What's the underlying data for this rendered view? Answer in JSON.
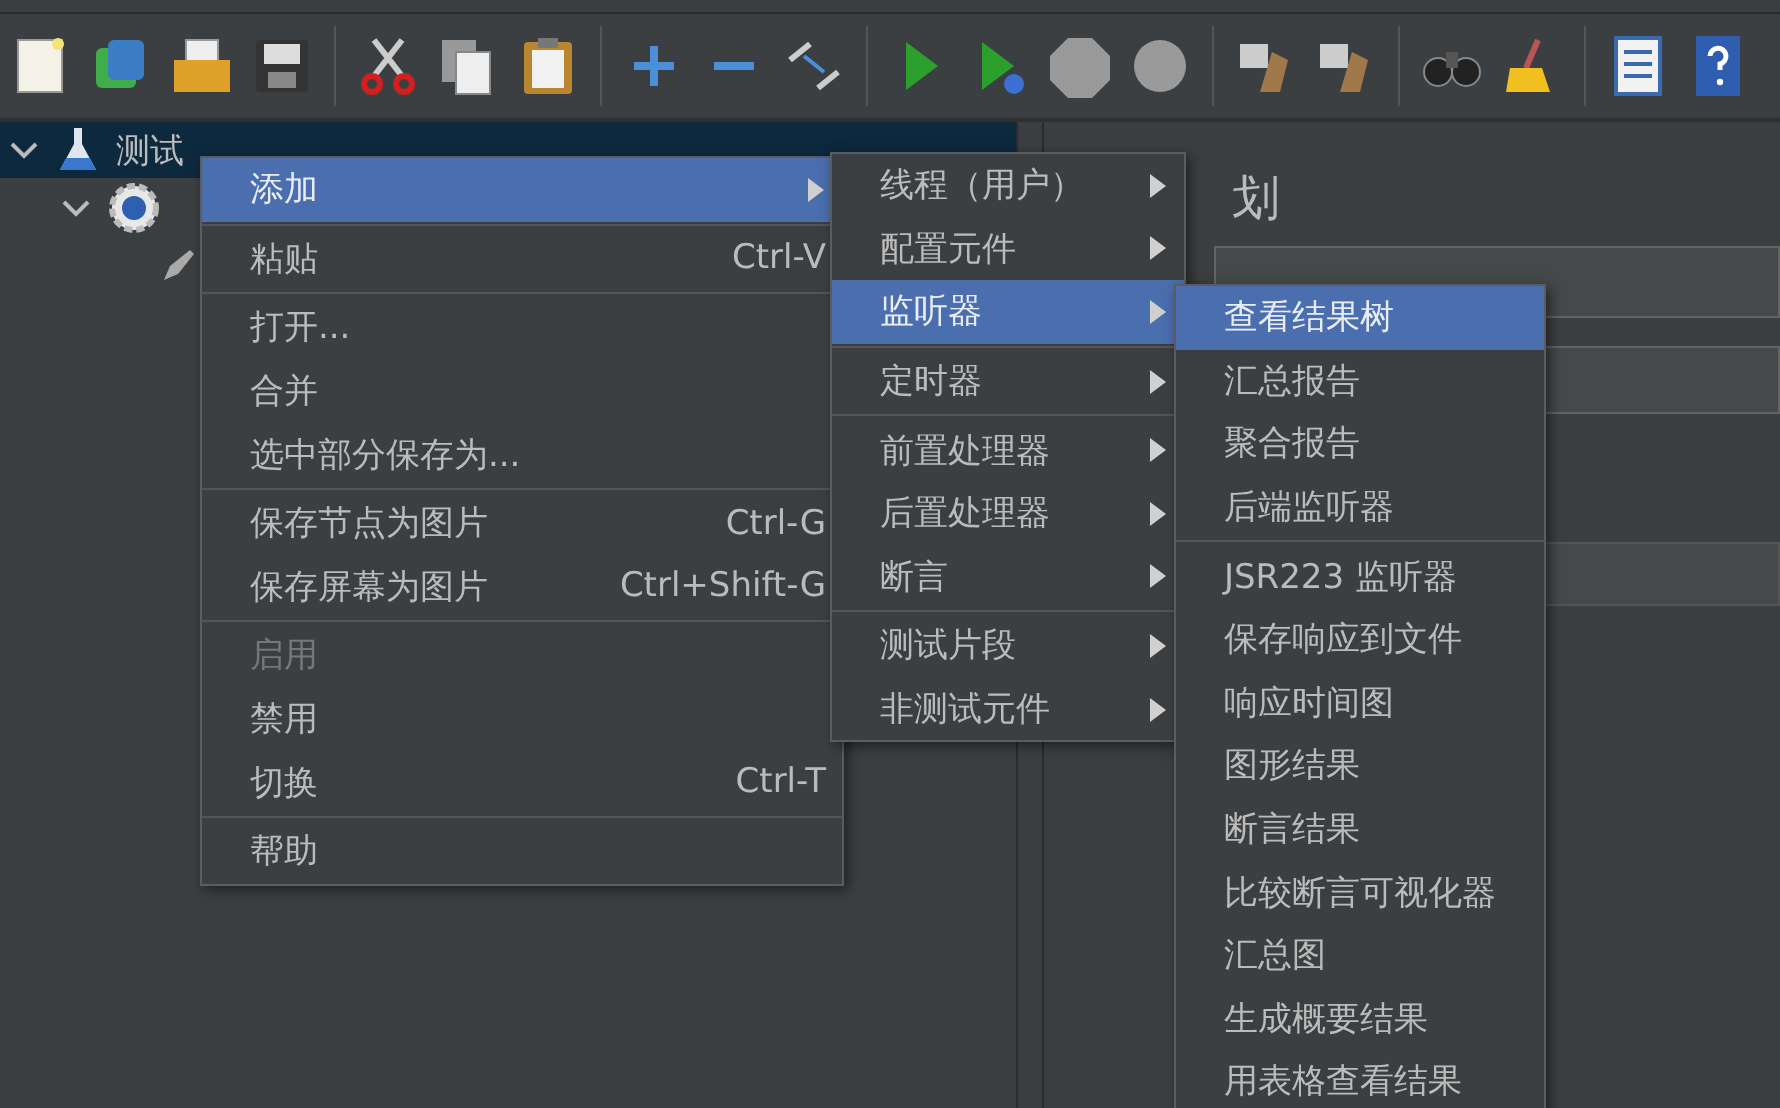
{
  "tree": {
    "items": [
      {
        "label": "测试",
        "selected": true,
        "expanded": true
      }
    ]
  },
  "panel": {
    "title": "划"
  },
  "menus": [
    {
      "items": [
        {
          "kind": "item",
          "label": "添加",
          "submenu": true,
          "selected": true,
          "disabled": false
        },
        {
          "kind": "separator"
        },
        {
          "kind": "item",
          "label": "粘贴",
          "shortcut": "Ctrl-V",
          "submenu": false,
          "selected": false,
          "disabled": false
        },
        {
          "kind": "separator"
        },
        {
          "kind": "item",
          "label": "打开...",
          "submenu": false,
          "selected": false,
          "disabled": false
        },
        {
          "kind": "item",
          "label": "合并",
          "submenu": false,
          "selected": false,
          "disabled": false
        },
        {
          "kind": "item",
          "label": "选中部分保存为...",
          "submenu": false,
          "selected": false,
          "disabled": false
        },
        {
          "kind": "separator"
        },
        {
          "kind": "item",
          "label": "保存节点为图片",
          "shortcut": "Ctrl-G",
          "submenu": false,
          "selected": false,
          "disabled": false
        },
        {
          "kind": "item",
          "label": "保存屏幕为图片",
          "shortcut": "Ctrl+Shift-G",
          "submenu": false,
          "selected": false,
          "disabled": false
        },
        {
          "kind": "separator"
        },
        {
          "kind": "item",
          "label": "启用",
          "submenu": false,
          "selected": false,
          "disabled": true
        },
        {
          "kind": "item",
          "label": "禁用",
          "submenu": false,
          "selected": false,
          "disabled": false
        },
        {
          "kind": "item",
          "label": "切换",
          "shortcut": "Ctrl-T",
          "submenu": false,
          "selected": false,
          "disabled": false
        },
        {
          "kind": "separator"
        },
        {
          "kind": "item",
          "label": "帮助",
          "submenu": false,
          "selected": false,
          "disabled": false
        }
      ]
    },
    {
      "items": [
        {
          "kind": "item",
          "label": "线程（用户）",
          "submenu": true,
          "selected": false,
          "disabled": false
        },
        {
          "kind": "item",
          "label": "配置元件",
          "submenu": true,
          "selected": false,
          "disabled": false
        },
        {
          "kind": "item",
          "label": "监听器",
          "submenu": true,
          "selected": true,
          "disabled": false
        },
        {
          "kind": "separator"
        },
        {
          "kind": "item",
          "label": "定时器",
          "submenu": true,
          "selected": false,
          "disabled": false
        },
        {
          "kind": "separator"
        },
        {
          "kind": "item",
          "label": "前置处理器",
          "submenu": true,
          "selected": false,
          "disabled": false
        },
        {
          "kind": "item",
          "label": "后置处理器",
          "submenu": true,
          "selected": false,
          "disabled": false
        },
        {
          "kind": "item",
          "label": "断言",
          "submenu": true,
          "selected": false,
          "disabled": false
        },
        {
          "kind": "separator"
        },
        {
          "kind": "item",
          "label": "测试片段",
          "submenu": true,
          "selected": false,
          "disabled": false
        },
        {
          "kind": "item",
          "label": "非测试元件",
          "submenu": true,
          "selected": false,
          "disabled": false
        }
      ]
    },
    {
      "items": [
        {
          "kind": "item",
          "label": "查看结果树",
          "submenu": false,
          "selected": true,
          "disabled": false
        },
        {
          "kind": "item",
          "label": "汇总报告",
          "submenu": false,
          "selected": false,
          "disabled": false
        },
        {
          "kind": "item",
          "label": "聚合报告",
          "submenu": false,
          "selected": false,
          "disabled": false
        },
        {
          "kind": "item",
          "label": "后端监听器",
          "submenu": false,
          "selected": false,
          "disabled": false
        },
        {
          "kind": "separator"
        },
        {
          "kind": "item",
          "label": "JSR223 监听器",
          "submenu": false,
          "selected": false,
          "disabled": false
        },
        {
          "kind": "item",
          "label": "保存响应到文件",
          "submenu": false,
          "selected": false,
          "disabled": false
        },
        {
          "kind": "item",
          "label": "响应时间图",
          "submenu": false,
          "selected": false,
          "disabled": false
        },
        {
          "kind": "item",
          "label": "图形结果",
          "submenu": false,
          "selected": false,
          "disabled": false
        },
        {
          "kind": "item",
          "label": "断言结果",
          "submenu": false,
          "selected": false,
          "disabled": false
        },
        {
          "kind": "item",
          "label": "比较断言可视化器",
          "submenu": false,
          "selected": false,
          "disabled": false
        },
        {
          "kind": "item",
          "label": "汇总图",
          "submenu": false,
          "selected": false,
          "disabled": false
        },
        {
          "kind": "item",
          "label": "生成概要结果",
          "submenu": false,
          "selected": false,
          "disabled": false
        },
        {
          "kind": "item",
          "label": "用表格查看结果",
          "submenu": false,
          "selected": false,
          "disabled": false
        }
      ]
    }
  ]
}
